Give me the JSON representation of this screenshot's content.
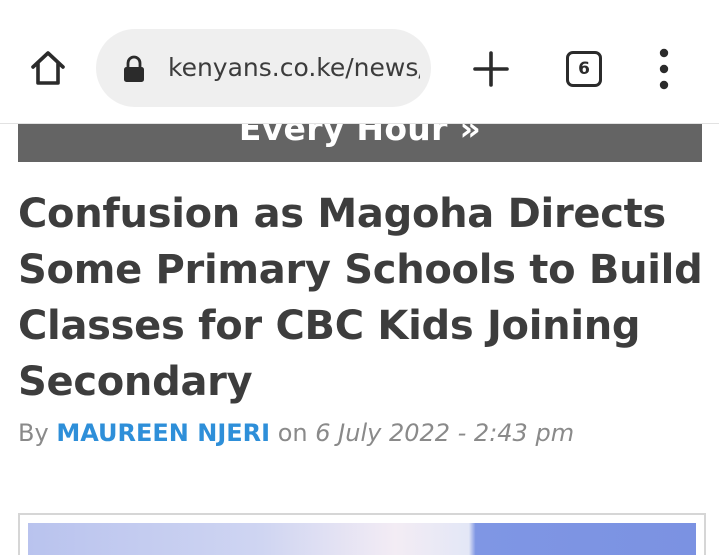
{
  "browser": {
    "url": "kenyans.co.ke/news/",
    "tab_count": "6",
    "icons": {
      "home": "home-icon",
      "lock": "lock-icon",
      "new_tab": "plus-icon",
      "menu": "more-vert-icon"
    }
  },
  "banner": {
    "text": "Every Hour »"
  },
  "article": {
    "headline": "Confusion as Magoha Directs Some Primary Schools to Build Classes for CBC Kids Joining Secondary",
    "byline_prefix": "By",
    "author": "MAUREEN NJERI",
    "byline_on": "on",
    "date": "6 July 2022 - 2:43 pm"
  },
  "colors": {
    "banner_bg": "#646464",
    "author_link": "#2e8fd9",
    "headline": "#3d3d3d"
  }
}
